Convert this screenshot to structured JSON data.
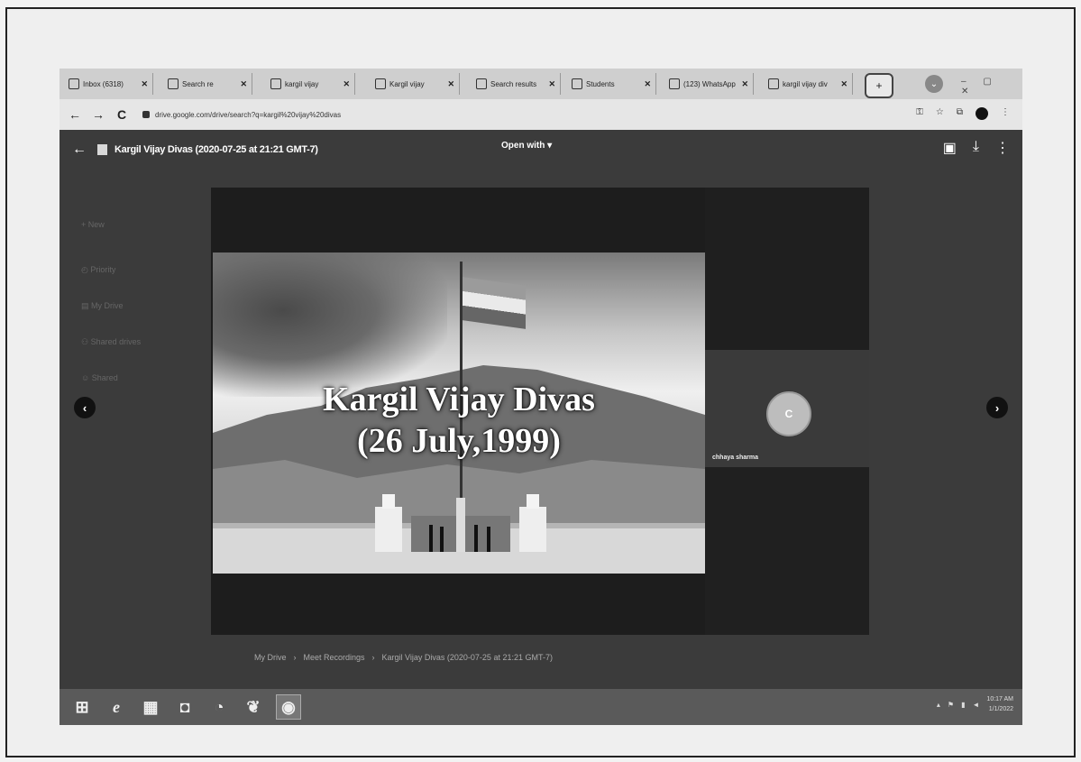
{
  "browser": {
    "tabs": [
      {
        "label": "Inbox (6318)"
      },
      {
        "label": "Search re"
      },
      {
        "label": "kargil vijay"
      },
      {
        "label": "Kargil vijay"
      },
      {
        "label": "Search results"
      },
      {
        "label": "Students"
      },
      {
        "label": "(123) WhatsApp"
      },
      {
        "label": "kargil vijay div"
      }
    ],
    "new_tab_label": "+",
    "url": "drive.google.com/drive/search?q=kargil%20vijay%20divas",
    "nav": {
      "back": "←",
      "forward": "→",
      "reload": "C"
    }
  },
  "viewer": {
    "file_title": "Kargil Vijay Divas (2020-07-25 at 21:21 GMT-7)",
    "open_with_label": "Open with ▾",
    "slide_title_line1": "Kargil Vijay Divas",
    "slide_title_line2": "(26 July,1999)",
    "participant_initial": "C",
    "participant_name": "chhaya sharma",
    "prev_label": "‹",
    "next_label": "›",
    "breadcrumb": [
      "My Drive",
      "Meet Recordings",
      "Kargil Vijay Divas (2020-07-25 at 21:21 GMT-7)"
    ]
  },
  "taskbar": {
    "time": "10:17 AM",
    "date": "1/1/2022"
  }
}
